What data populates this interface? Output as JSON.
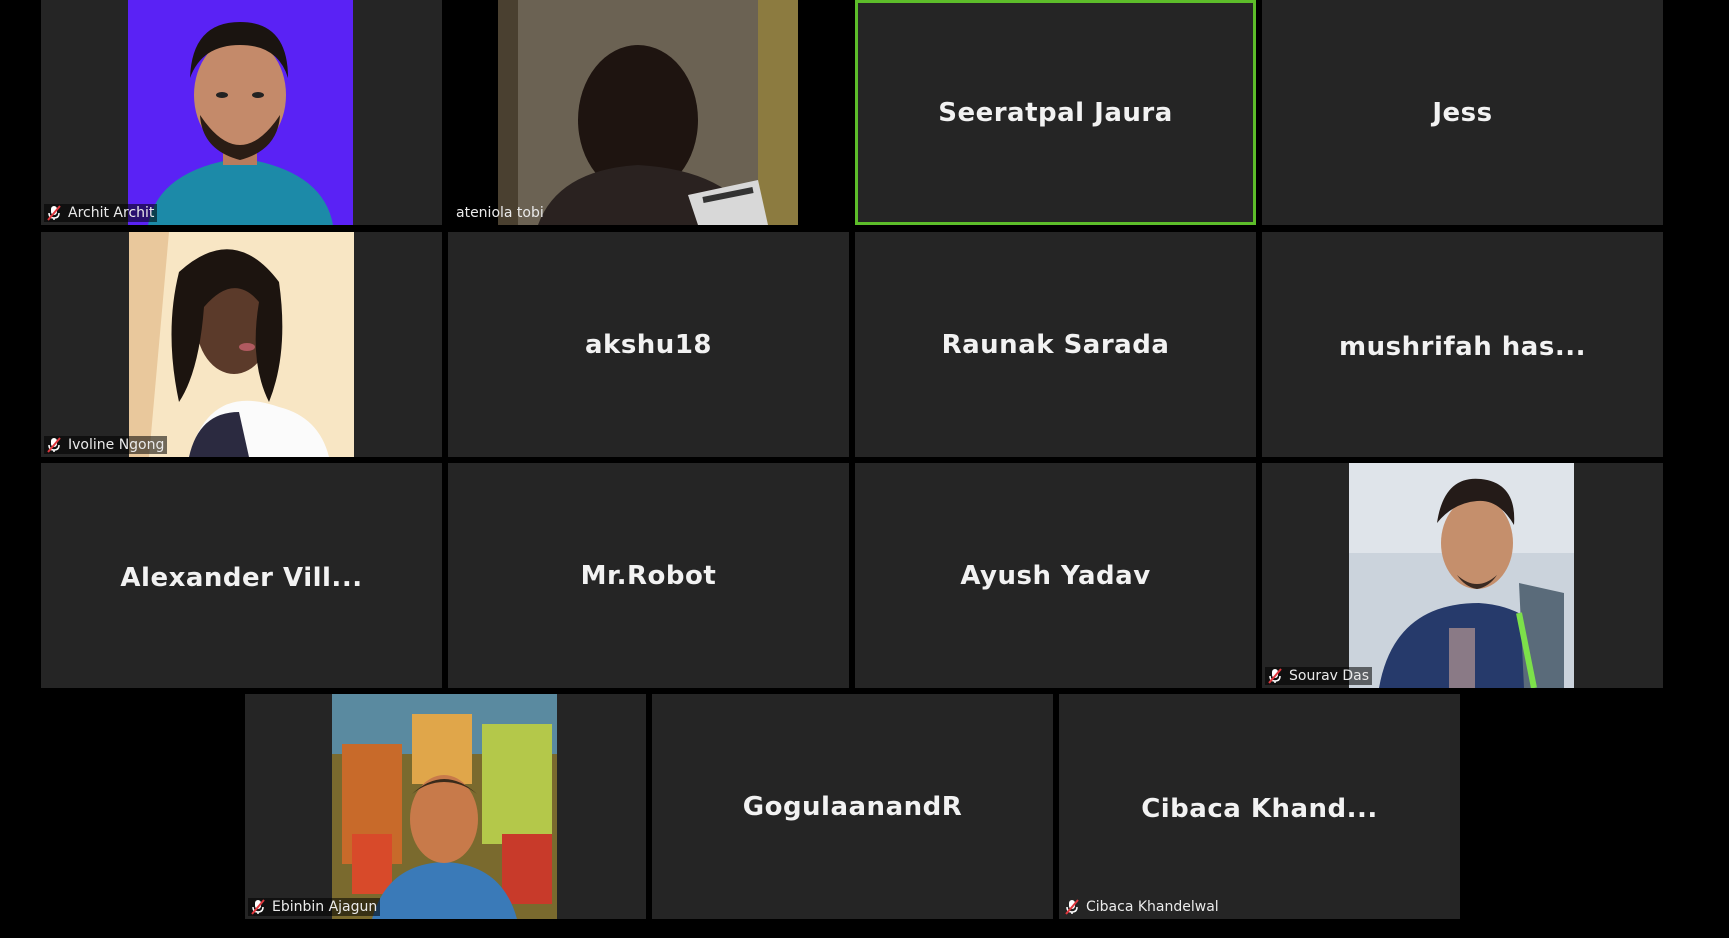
{
  "meeting": {
    "layout": "gallery-view",
    "active_speaker_border": "#5dbd2a",
    "tile_background": "#252525",
    "participants": [
      {
        "name": "Archit Archit",
        "display": "",
        "muted": true,
        "video": "photo-portrait-blue"
      },
      {
        "name": "ateniola tobi",
        "display": "",
        "muted": false,
        "video": "camera-feed-dark-room"
      },
      {
        "name": "Seeratpal Jaura",
        "display": "Seeratpal Jaura",
        "muted": false,
        "video": "none",
        "active": true
      },
      {
        "name": "Jess",
        "display": "Jess",
        "muted": false,
        "video": "none"
      },
      {
        "name": "Ivoline Ngong",
        "display": "",
        "muted": true,
        "video": "photo-portrait-bright"
      },
      {
        "name": "akshu18",
        "display": "akshu18",
        "muted": false,
        "video": "none"
      },
      {
        "name": "Raunak Sarada",
        "display": "Raunak Sarada",
        "muted": false,
        "video": "none"
      },
      {
        "name": "mushrifah has...",
        "display": "mushrifah has...",
        "muted": false,
        "video": "none"
      },
      {
        "name": "Alexander Vill...",
        "display": "Alexander Vill...",
        "muted": false,
        "video": "none"
      },
      {
        "name": "Mr.Robot",
        "display": "Mr.Robot",
        "muted": false,
        "video": "none"
      },
      {
        "name": "Ayush Yadav",
        "display": "Ayush Yadav",
        "muted": false,
        "video": "none"
      },
      {
        "name": "Sourav Das",
        "display": "",
        "muted": true,
        "video": "photo-portrait-outdoor"
      },
      {
        "name": "Ebinbin Ajagun",
        "display": "",
        "muted": true,
        "video": "photo-painted-colorful"
      },
      {
        "name": "GogulaanandR",
        "display": "GogulaanandR",
        "muted": false,
        "video": "none"
      },
      {
        "name": "Cibaca Khandelwal",
        "display": "Cibaca Khand...",
        "muted": true,
        "video": "none"
      }
    ]
  },
  "icons": {
    "mute": "mic-muted-icon"
  }
}
